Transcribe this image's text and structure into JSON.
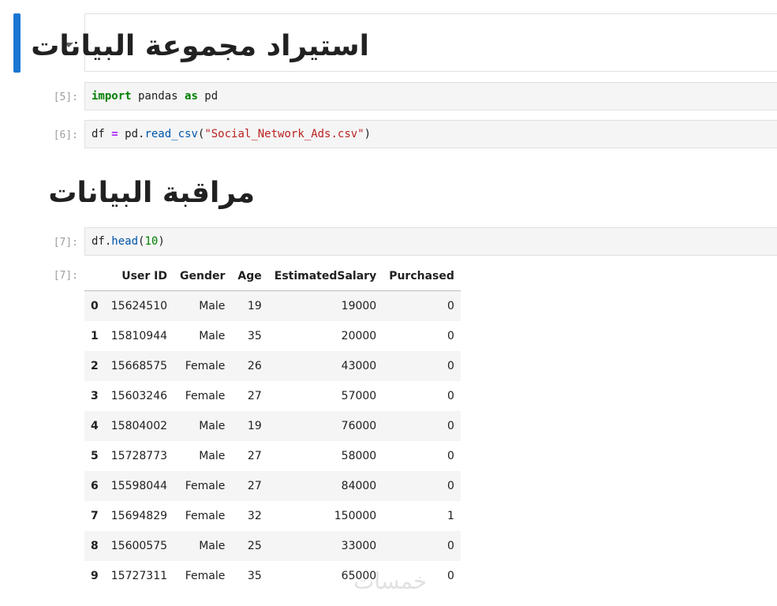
{
  "markdown": {
    "heading1": "استيراد مجموعة البيانات",
    "heading2": "مراقبة البيانات"
  },
  "cells": [
    {
      "prompt": "[5]:",
      "code": {
        "kw1": "import",
        "mid": " pandas ",
        "kw2": "as",
        "end": " pd"
      }
    },
    {
      "prompt": "[6]:",
      "code": {
        "lhs": "df ",
        "op": "=",
        "obj": " pd.",
        "fn": "read_csv",
        "open": "(",
        "str": "\"Social_Network_Ads.csv\"",
        "close": ")"
      }
    },
    {
      "prompt": "[7]:",
      "code": {
        "obj": "df.",
        "fn": "head",
        "open": "(",
        "num": "10",
        "close": ")"
      }
    }
  ],
  "output": {
    "prompt": "[7]:",
    "columns": [
      "",
      "User ID",
      "Gender",
      "Age",
      "EstimatedSalary",
      "Purchased"
    ],
    "rows": [
      [
        "0",
        "15624510",
        "Male",
        "19",
        "19000",
        "0"
      ],
      [
        "1",
        "15810944",
        "Male",
        "35",
        "20000",
        "0"
      ],
      [
        "2",
        "15668575",
        "Female",
        "26",
        "43000",
        "0"
      ],
      [
        "3",
        "15603246",
        "Female",
        "27",
        "57000",
        "0"
      ],
      [
        "4",
        "15804002",
        "Male",
        "19",
        "76000",
        "0"
      ],
      [
        "5",
        "15728773",
        "Male",
        "27",
        "58000",
        "0"
      ],
      [
        "6",
        "15598044",
        "Female",
        "27",
        "84000",
        "0"
      ],
      [
        "7",
        "15694829",
        "Female",
        "32",
        "150000",
        "1"
      ],
      [
        "8",
        "15600575",
        "Male",
        "25",
        "33000",
        "0"
      ],
      [
        "9",
        "15727311",
        "Female",
        "35",
        "65000",
        "0"
      ]
    ]
  },
  "watermark": "خمسات",
  "colors": {
    "active_cell": "#1976d2",
    "keyword": "#008000",
    "string": "#ba2121",
    "function": "#0055aa"
  }
}
